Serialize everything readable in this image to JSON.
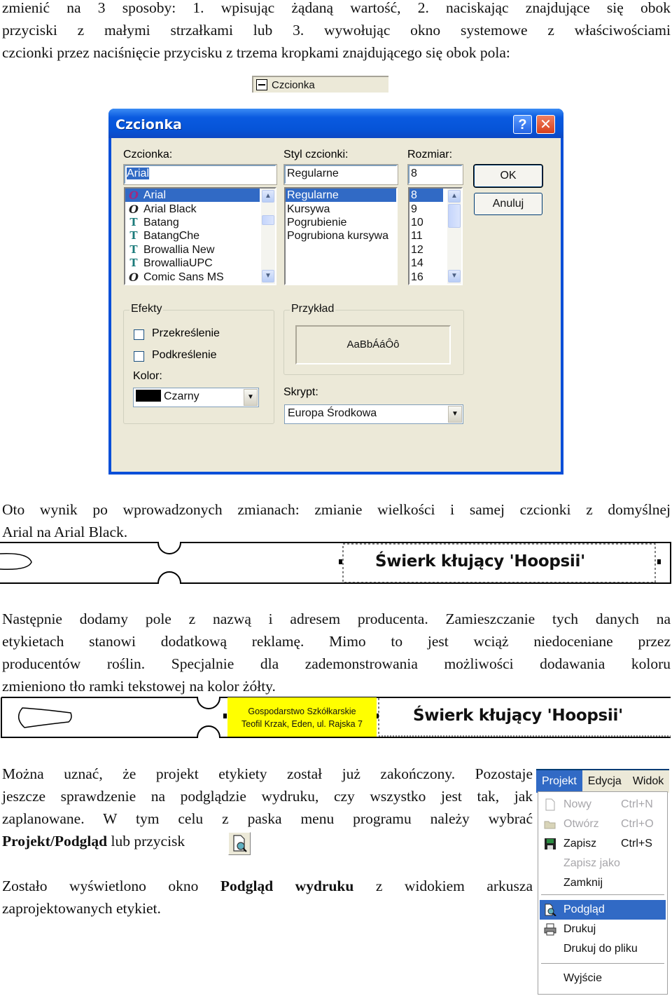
{
  "paragraphs": {
    "intro": [
      "zmienić na 3 sposoby: 1. wpisując żądaną wartość, 2. naciskając znajdujące się obok",
      "przyciski z małymi strzałkami lub 3. wywołując okno systemowe z właściwościami",
      "czcionki przez naciśnięcie przycisku z trzema kropkami znajdującego się obok pola:"
    ],
    "result": [
      "Oto wynik po wprowadzonych zmianach: zmianie wielkości i samej czcionki z domyślnej",
      "Arial na Arial Black."
    ],
    "producer": [
      "Następnie dodamy pole z nazwą i adresem producenta. Zamieszczanie tych danych na",
      "etykietach stanowi dodatkową reklamę. Mimo to jest wciąż niedoceniane przez",
      "producentów roślin. Specjalnie dla zademonstrowania możliwości dodawania koloru",
      "zmieniono tło ramki tekstowej na kolor żółty."
    ],
    "finish": [
      "Można uznać, że projekt etykiety został już zakończony. Pozostaje",
      "jeszcze sprawdzenie na podglądzie wydruku, czy wszystko jest tak, jak",
      "zaplanowane. W tym celu z paska menu programu należy wybrać"
    ],
    "finish_last_bold": "Projekt/Podgląd",
    "finish_last_rest": " lub przycisk",
    "preview_1": "Zostało wyświetlono okno ",
    "preview_bold": "Podgląd wydruku",
    "preview_2": " z widokiem arkusza",
    "preview_last": "zaprojektowanych etykiet."
  },
  "group_header": {
    "label": "Czcionka",
    "icon": "collapse-minus-icon"
  },
  "font_dialog": {
    "title": "Czcionka",
    "help_button": "?",
    "close_button": "✕",
    "font_label": "Czcionka:",
    "font_value": "Arial",
    "fonts": [
      {
        "name": "Arial",
        "icon": "O"
      },
      {
        "name": "Arial Black",
        "icon": "O"
      },
      {
        "name": "Batang",
        "icon": "TT"
      },
      {
        "name": "BatangChe",
        "icon": "TT"
      },
      {
        "name": "Browallia New",
        "icon": "TT"
      },
      {
        "name": "BrowalliaUPC",
        "icon": "TT"
      },
      {
        "name": "Comic Sans MS",
        "icon": "O"
      }
    ],
    "style_label": "Styl czcionki:",
    "style_value": "Regularne",
    "styles": [
      "Regularne",
      "Kursywa",
      "Pogrubienie",
      "Pogrubiona kursywa"
    ],
    "size_label": "Rozmiar:",
    "size_value": "8",
    "sizes": [
      "8",
      "9",
      "10",
      "11",
      "12",
      "14",
      "16"
    ],
    "ok_button": "OK",
    "cancel_button": "Anuluj",
    "effects_label": "Efekty",
    "strikeout_label": "Przekreślenie",
    "strikeout_checked": false,
    "underline_label": "Podkreślenie",
    "underline_checked": false,
    "color_label": "Kolor:",
    "color_value": "Czarny",
    "color_swatch": "#000000",
    "sample_label": "Przykład",
    "sample_text": "AaBbÁáÔô",
    "script_label": "Skrypt:",
    "script_value": "Europa Środkowa"
  },
  "label_strip_1": {
    "headline": "Świerk kłujący 'Hoopsii'"
  },
  "label_strip_2": {
    "producer_line1": "Gospodarstwo Szkółkarskie",
    "producer_line2": "Teofil Krzak, Eden, ul. Rajska 7",
    "producer_bg": "#ffff00",
    "headline": "Świerk kłujący 'Hoopsii'"
  },
  "preview_button": {
    "icon": "print-preview-icon"
  },
  "menu": {
    "bar": [
      "Projekt",
      "Edycja",
      "Widok"
    ],
    "items": [
      {
        "label": "Nowy",
        "shortcut": "Ctrl+N",
        "disabled": true,
        "icon": "new-document-icon"
      },
      {
        "label": "Otwórz",
        "shortcut": "Ctrl+O",
        "disabled": true,
        "icon": "open-folder-icon"
      },
      {
        "label": "Zapisz",
        "shortcut": "Ctrl+S",
        "disabled": false,
        "icon": "save-disk-icon"
      },
      {
        "label": "Zapisz jako",
        "shortcut": "",
        "disabled": true
      },
      {
        "label": "Zamknij",
        "shortcut": "",
        "disabled": false
      },
      {
        "label": "Podgląd",
        "shortcut": "",
        "disabled": false,
        "highlighted": true,
        "icon": "print-preview-icon"
      },
      {
        "label": "Drukuj",
        "shortcut": "",
        "disabled": false,
        "icon": "printer-icon"
      },
      {
        "label": "Drukuj do pliku",
        "shortcut": "",
        "disabled": false
      },
      {
        "label": "Wyjście",
        "shortcut": "",
        "disabled": false
      }
    ]
  }
}
